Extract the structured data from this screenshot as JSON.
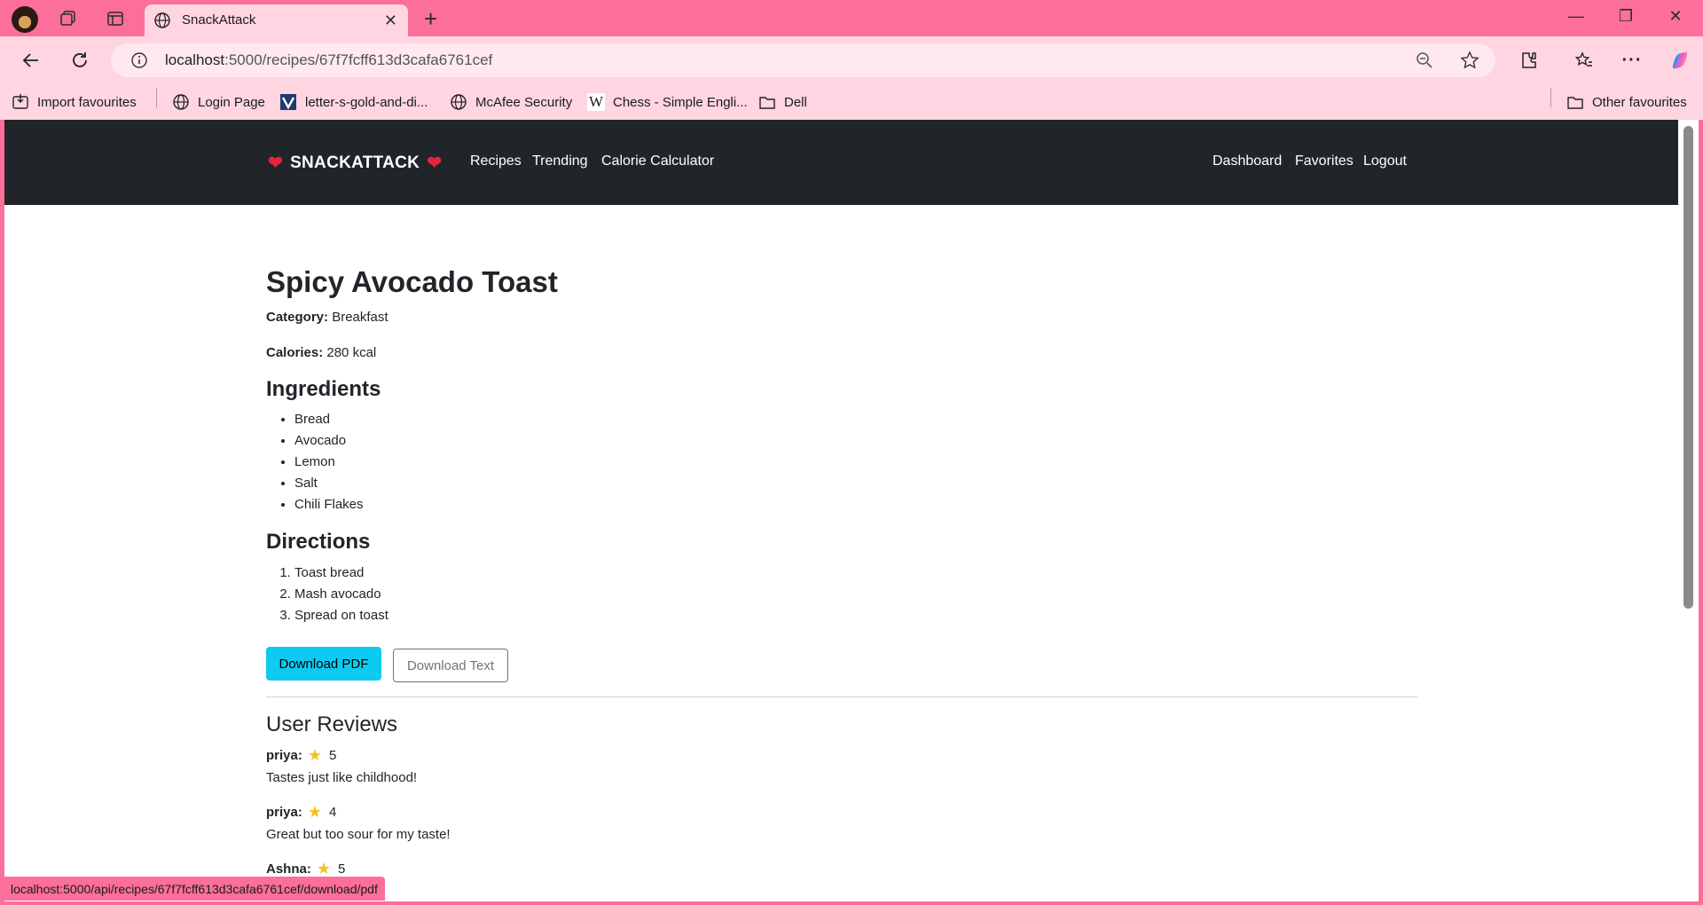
{
  "browser": {
    "tab_title": "SnackAttack",
    "url_host": "localhost",
    "url_rest": ":5000/recipes/67f7fcff613d3cafa6761cef",
    "status_url": "localhost:5000/api/recipes/67f7fcff613d3cafa6761cef/download/pdf"
  },
  "bookmarks": {
    "items": [
      {
        "label": "Import favourites",
        "icon": "import-icon"
      },
      {
        "label": "Login Page",
        "icon": "globe-icon"
      },
      {
        "label": "letter-s-gold-and-di...",
        "icon": "vector-site-icon"
      },
      {
        "label": "McAfee Security",
        "icon": "globe-icon"
      },
      {
        "label": "Chess - Simple Engli...",
        "icon": "wikipedia-icon"
      },
      {
        "label": "Dell",
        "icon": "folder-icon"
      }
    ],
    "other": "Other favourites"
  },
  "navbar": {
    "brand": "SNACKATTACK",
    "brand_emoji": "❤️",
    "links": [
      "Recipes",
      "Trending",
      "Calorie Calculator"
    ],
    "right_links": [
      "Dashboard",
      "Favorites",
      "Logout"
    ]
  },
  "recipe": {
    "title": "Spicy Avocado Toast",
    "category_label": "Category:",
    "category": "Breakfast",
    "calories_label": "Calories:",
    "calories": "280 kcal",
    "ingredients_heading": "Ingredients",
    "ingredients": [
      "Bread",
      "Avocado",
      "Lemon",
      "Salt",
      "Chili Flakes"
    ],
    "directions_heading": "Directions",
    "directions": [
      "Toast bread",
      "Mash avocado",
      "Spread on toast"
    ],
    "download_pdf": "Download PDF",
    "download_text": "Download Text"
  },
  "reviews": {
    "heading": "User Reviews",
    "items": [
      {
        "user": "priya:",
        "rating": "5",
        "text": "Tastes just like childhood!"
      },
      {
        "user": "priya:",
        "rating": "4",
        "text": "Great but too sour for my taste!"
      },
      {
        "user": "Ashna:",
        "rating": "5",
        "text": ""
      }
    ]
  },
  "colors": {
    "browser_frame": "#fb6f9a",
    "browser_toolbar": "#ffd5e1",
    "navbar_bg": "#212529",
    "primary_button": "#0dcaf0",
    "heart": "#e8243c",
    "star": "#f4c21b"
  }
}
